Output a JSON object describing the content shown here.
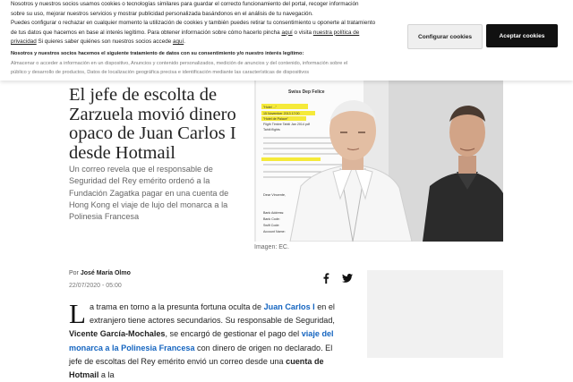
{
  "cookie_banner": {
    "line1": "Nosotros y nuestros socios usamos cookies o tecnologías similares para guardar el correcto funcionamiento del portal, recoger información",
    "line2": "sobre su uso, mejorar nuestros servicios y mostrar publicidad personalizada basándonos en el análisis de tu navegación.",
    "line3": "Puedes configurar o rechazar en cualquier momento la utilización de cookies y también puedes retirar tu consentimiento u oponerte al tratamiento",
    "line4_pre": "de tus datos que hacemos en base al interés legítimo. Para obtener información sobre cómo hacerlo pincha ",
    "link_aqui_1": "aquí",
    "line4_mid": " o visita ",
    "link_policy_part1": "nuestra política de",
    "link_policy_part2": "privacidad",
    "line5_post": " Si quieres saber quiénes son nuestros socios accede ",
    "link_aqui_2": "aquí",
    "line5_end": ".",
    "purposes_heading": "Nosotros y nuestros socios hacemos el siguiente tratamiento de datos con su consentimiento y/o nuestro interés legítimo:",
    "purposes_line1": "Almacenar o acceder a información en un dispositivo, Anuncios y contenido personalizados, medición de anuncios y del contenido, información sobre el",
    "purposes_line2": "público y desarrollo de productos, Datos de localización geográfica precisa e identificación mediante las características de dispositivos",
    "configure_button": "Configurar cookies",
    "accept_button": "Aceptar cookies"
  },
  "article": {
    "headline": "El jefe de escolta de Zarzuela movió dinero opaco de Juan Carlos I desde Hotmail",
    "subheadline": "Un correo revela que el responsable de Seguridad del Rey emérito ordenó a la Fundación Zagatka pagar en una cuenta de Hong Kong el viaje de lujo del monarca a la Polinesia Francesa",
    "image_caption": "Imagen: EC.",
    "byline_prefix": "Por ",
    "author": "José María Olmo",
    "date": "22/07/2020 - 05:00",
    "body": {
      "dropcap": "L",
      "p1": "a trama en torno a la presunta fortuna oculta de ",
      "link_juan_carlos": "Juan Carlos I",
      "p2": " en el extranjero tiene actores secundarios. Su responsable de Seguridad, ",
      "bold_name": "Vicente García-Mochales",
      "p3": ", se encargó de gestionar el pago del ",
      "link_viaje": "viaje del monarca a la Polinesia Francesa",
      "p4": " con dinero de origen no declarado. El jefe de escoltas del Rey emérito envió un correo desde una ",
      "bold_hotmail": "cuenta de Hotmail",
      "p5": " a la"
    }
  },
  "hero_image": {
    "document_heading": "Swiss Dep Felice",
    "document_lines": [
      "\"Hotel ...\"",
      "15 November 2013 17:00",
      "\"Hotel de Palace\"",
      "Fligth Timbre Tahiti Jan 2014 pdf",
      "Tahiti flights",
      "Dear Vincente,",
      "Bank Address:",
      "Bank Code:",
      "Swift Code:",
      "Account Name:"
    ],
    "highlight_color": "#f5ea3a"
  },
  "share": {
    "facebook_icon": "facebook-icon",
    "twitter_icon": "twitter-icon"
  }
}
